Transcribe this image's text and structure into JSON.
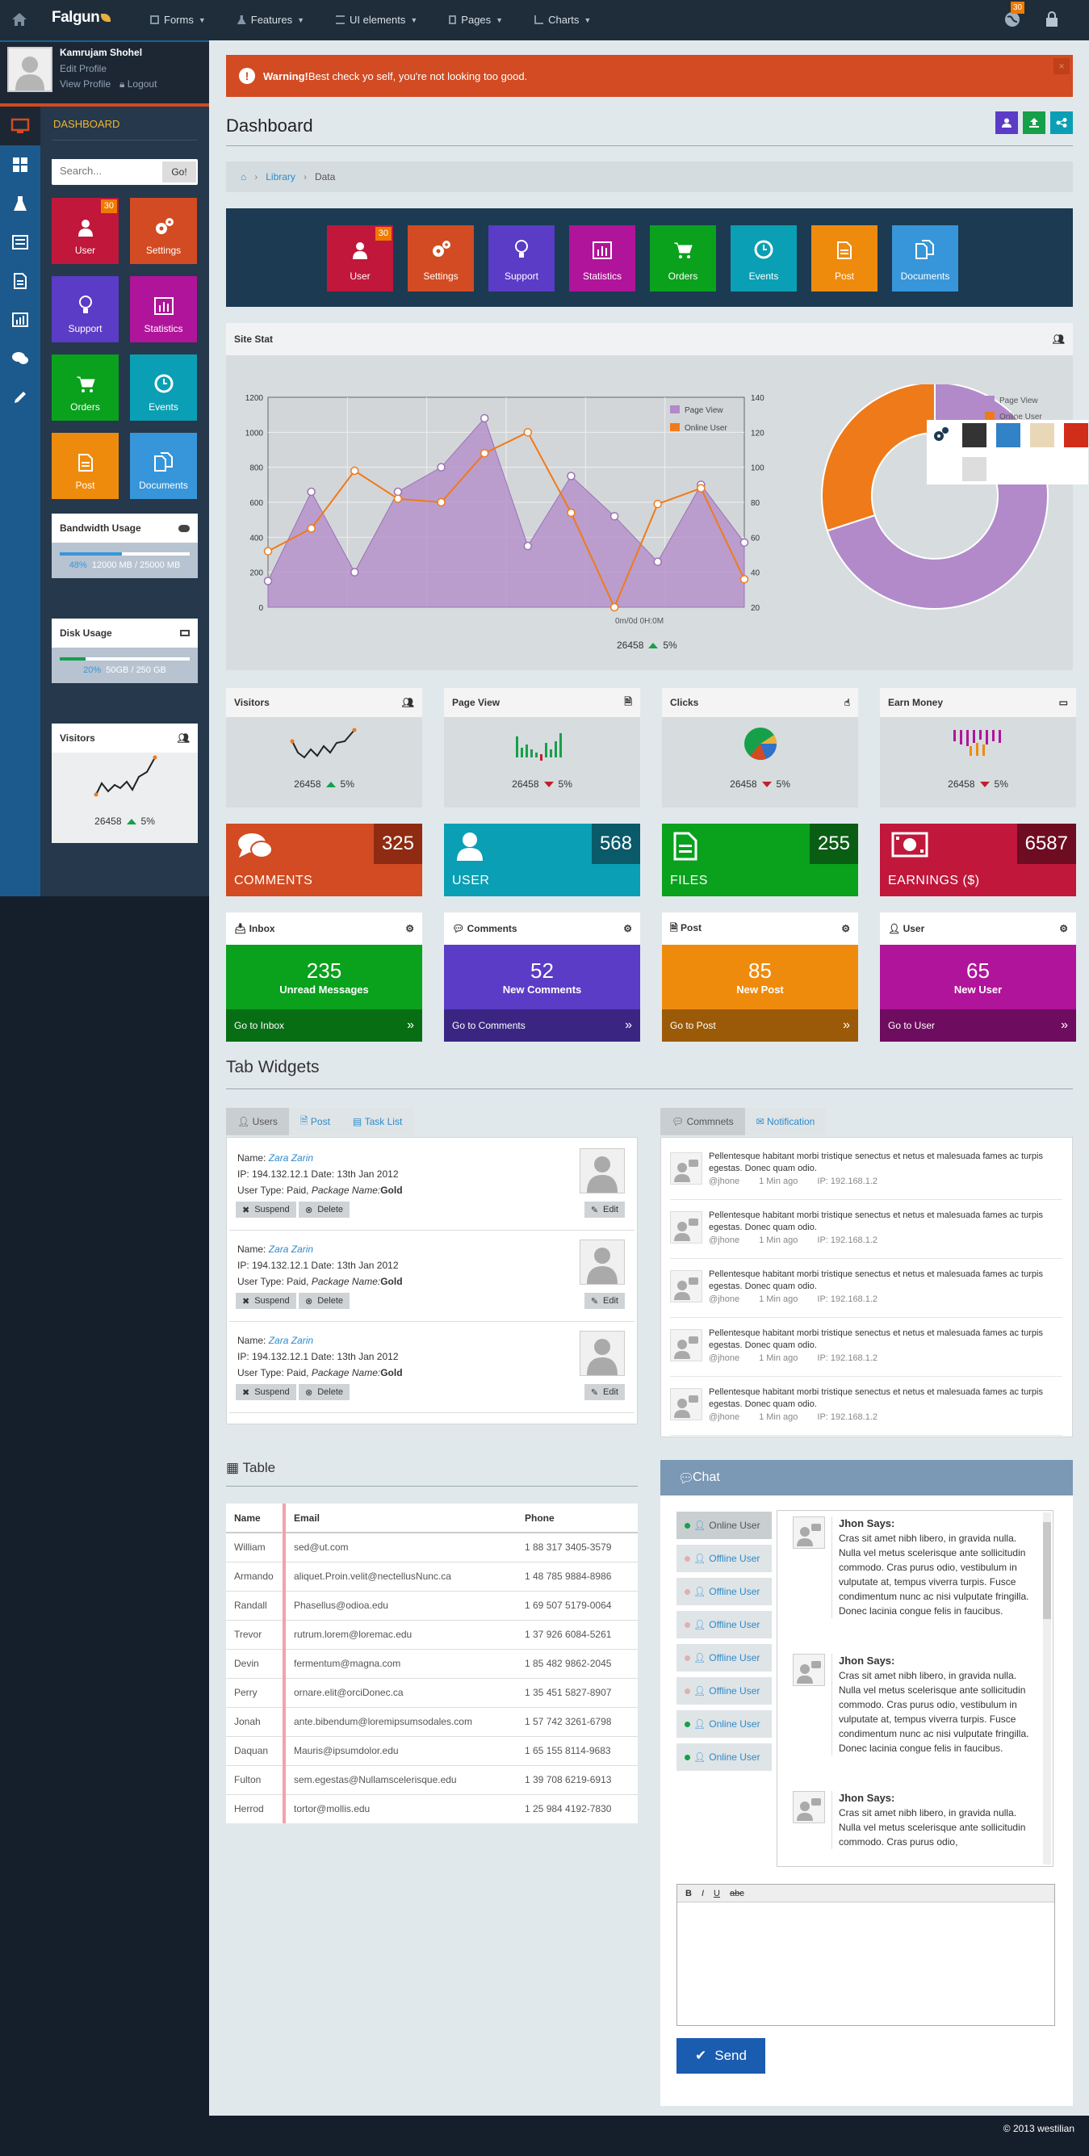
{
  "topbar": {
    "brand": "Falgun",
    "nav": [
      "Forms",
      "Features",
      "UI elements",
      "Pages",
      "Charts"
    ],
    "notif_count": "30"
  },
  "profile": {
    "name": "Kamrujam Shohel",
    "edit": "Edit Profile",
    "view": "View Profile",
    "logout": "Logout"
  },
  "sidebar": {
    "section": "DASHBOARD",
    "search_placeholder": "Search...",
    "search_go": "Go!",
    "tiles": [
      {
        "label": "User",
        "color": "#c0173b",
        "badge": "30"
      },
      {
        "label": "Settings",
        "color": "#d24b22"
      },
      {
        "label": "Support",
        "color": "#5a3cc6"
      },
      {
        "label": "Statistics",
        "color": "#b0149a"
      },
      {
        "label": "Orders",
        "color": "#0aa11d"
      },
      {
        "label": "Events",
        "color": "#0a9fb4"
      },
      {
        "label": "Post",
        "color": "#ef8b0c"
      },
      {
        "label": "Documents",
        "color": "#3796d9"
      }
    ],
    "bandwidth": {
      "title": "Bandwidth Usage",
      "percent": "48%",
      "detail": "12000 MB / 25000 MB",
      "fill": 0.48
    },
    "disk": {
      "title": "Disk Usage",
      "percent": "20%",
      "detail": "50GB / 250 GB",
      "fill": 0.2
    },
    "visitors": {
      "title": "Visitors",
      "value": "26458",
      "change": "5%"
    }
  },
  "alert": {
    "strong": "Warning!",
    "text": " Best check yo self, you're not looking too good."
  },
  "page": {
    "title": "Dashboard"
  },
  "breadcrumb": {
    "library": "Library",
    "current": "Data"
  },
  "hero_tiles": [
    {
      "label": "User",
      "color": "#c0173b",
      "badge": "30"
    },
    {
      "label": "Settings",
      "color": "#d24b22"
    },
    {
      "label": "Support",
      "color": "#5a3cc6"
    },
    {
      "label": "Statistics",
      "color": "#b0149a"
    },
    {
      "label": "Orders",
      "color": "#0aa11d"
    },
    {
      "label": "Events",
      "color": "#0a9fb4"
    },
    {
      "label": "Post",
      "color": "#ef8b0c"
    },
    {
      "label": "Documents",
      "color": "#3796d9"
    }
  ],
  "site_stat": {
    "title": "Site Stat",
    "footer_value": "26458",
    "footer_change": "5%",
    "overlay_text": "0m/0d 0H:0M"
  },
  "chart_data": [
    {
      "type": "line",
      "title": "Site Stat",
      "x": [
        0,
        1,
        2,
        3,
        4,
        5,
        6,
        7,
        8,
        9,
        10,
        11,
        12,
        13
      ],
      "y_left_range": [
        0,
        1200
      ],
      "y_right_range": [
        20,
        140
      ],
      "y_left_ticks": [
        0,
        200,
        400,
        600,
        800,
        1000,
        1200
      ],
      "y_right_ticks": [
        20,
        40,
        60,
        80,
        100,
        120,
        140
      ],
      "legend_position": "top-right",
      "series": [
        {
          "name": "Page View",
          "axis": "left",
          "kind": "area",
          "color": "#b28ac9",
          "values": [
            150,
            660,
            200,
            660,
            800,
            1080,
            350,
            750,
            520,
            260,
            700,
            370,
            0,
            0
          ]
        },
        {
          "name": "Online User",
          "axis": "right",
          "kind": "line",
          "color": "#ef7a1a",
          "values": [
            52,
            65,
            98,
            82,
            80,
            108,
            120,
            74,
            20,
            79,
            88,
            36,
            0,
            0
          ]
        }
      ]
    },
    {
      "type": "pie",
      "donut": true,
      "legend": [
        "Page View",
        "Online User"
      ],
      "values": [
        70,
        30
      ],
      "colors": [
        "#b28ac9",
        "#ef7a1a"
      ]
    }
  ],
  "stat_cards": [
    {
      "title": "Visitors",
      "value": "26458",
      "change": "5%",
      "dir": "up"
    },
    {
      "title": "Page View",
      "value": "26458",
      "change": "5%",
      "dir": "down"
    },
    {
      "title": "Clicks",
      "value": "26458",
      "change": "5%",
      "dir": "down"
    },
    {
      "title": "Earn Money",
      "value": "26458",
      "change": "5%",
      "dir": "down"
    }
  ],
  "metric_cards": [
    {
      "label": "COMMENTS",
      "value": "325",
      "color": "#d24b22",
      "dark": "#8f2b12"
    },
    {
      "label": "USER",
      "value": "568",
      "color": "#0a9fb4",
      "dark": "#0a5a6a"
    },
    {
      "label": "FILES",
      "value": "255",
      "color": "#0aa11d",
      "dark": "#0a5e14"
    },
    {
      "label": "EARNINGS ($)",
      "value": "6587",
      "color": "#c0173b",
      "dark": "#6e0c22"
    }
  ],
  "info_cards": [
    {
      "title": "Inbox",
      "number": "235",
      "text": "Unread Messages",
      "link": "Go to Inbox",
      "color": "#0aa11d",
      "dark": "#086e14"
    },
    {
      "title": "Comments",
      "number": "52",
      "text": "New Comments",
      "link": "Go to Comments",
      "color": "#5a3cc6",
      "dark": "#3a2682"
    },
    {
      "title": "Post",
      "number": "85",
      "text": "New Post",
      "link": "Go to Post",
      "color": "#ef8b0c",
      "dark": "#9a5a08"
    },
    {
      "title": "User",
      "number": "65",
      "text": "New User",
      "link": "Go to User",
      "color": "#b0149a",
      "dark": "#6e0c60"
    }
  ],
  "tab_widgets": {
    "title": "Tab Widgets",
    "left_tabs": [
      "Users",
      "Post",
      "Task List"
    ],
    "right_tabs": [
      "Commnets",
      "Notification"
    ],
    "users": [
      {
        "name_label": "Name:",
        "name": "Zara Zarin",
        "ip_line": "IP: 194.132.12.1 Date: 13th Jan 2012",
        "type_prefix": "User Type: Paid,",
        "pkg_label": "Package Name:",
        "pkg": "Gold"
      },
      {
        "name_label": "Name:",
        "name": "Zara Zarin",
        "ip_line": "IP: 194.132.12.1 Date: 13th Jan 2012",
        "type_prefix": "User Type: Paid,",
        "pkg_label": "Package Name:",
        "pkg": "Gold"
      },
      {
        "name_label": "Name:",
        "name": "Zara Zarin",
        "ip_line": "IP: 194.132.12.1 Date: 13th Jan 2012",
        "type_prefix": "User Type: Paid,",
        "pkg_label": "Package Name:",
        "pkg": "Gold"
      }
    ],
    "suspend": "Suspend",
    "delete": "Delete",
    "edit": "Edit",
    "comments": [
      {
        "text": "Pellentesque habitant morbi tristique senectus et netus et malesuada fames ac turpis egestas. Donec quam odio.",
        "user": "@jhone",
        "time": "1 Min ago",
        "ip": "IP: 192.168.1.2"
      },
      {
        "text": "Pellentesque habitant morbi tristique senectus et netus et malesuada fames ac turpis egestas. Donec quam odio.",
        "user": "@jhone",
        "time": "1 Min ago",
        "ip": "IP: 192.168.1.2"
      },
      {
        "text": "Pellentesque habitant morbi tristique senectus et netus et malesuada fames ac turpis egestas. Donec quam odio.",
        "user": "@jhone",
        "time": "1 Min ago",
        "ip": "IP: 192.168.1.2"
      },
      {
        "text": "Pellentesque habitant morbi tristique senectus et netus et malesuada fames ac turpis egestas. Donec quam odio.",
        "user": "@jhone",
        "time": "1 Min ago",
        "ip": "IP: 192.168.1.2"
      },
      {
        "text": "Pellentesque habitant morbi tristique senectus et netus et malesuada fames ac turpis egestas. Donec quam odio.",
        "user": "@jhone",
        "time": "1 Min ago",
        "ip": "IP: 192.168.1.2"
      }
    ]
  },
  "table": {
    "title": "Table",
    "headers": [
      "Name",
      "Email",
      "Phone"
    ],
    "rows": [
      [
        "William",
        "sed@ut.com",
        "1 88 317 3405-3579"
      ],
      [
        "Armando",
        "aliquet.Proin.velit@nectellusNunc.ca",
        "1 48 785 9884-8986"
      ],
      [
        "Randall",
        "Phasellus@odioa.edu",
        "1 69 507 5179-0064"
      ],
      [
        "Trevor",
        "rutrum.lorem@loremac.edu",
        "1 37 926 6084-5261"
      ],
      [
        "Devin",
        "fermentum@magna.com",
        "1 85 482 9862-2045"
      ],
      [
        "Perry",
        "ornare.elit@orciDonec.ca",
        "1 35 451 5827-8907"
      ],
      [
        "Jonah",
        "ante.bibendum@loremipsumsodales.com",
        "1 57 742 3261-6798"
      ],
      [
        "Daquan",
        "Mauris@ipsumdolor.edu",
        "1 65 155 8114-9683"
      ],
      [
        "Fulton",
        "sem.egestas@Nullamscelerisque.edu",
        "1 39 708 6219-6913"
      ],
      [
        "Herrod",
        "tortor@mollis.edu",
        "1 25 984 4192-7830"
      ]
    ]
  },
  "chat": {
    "title": "Chat",
    "users": [
      {
        "status": "Online User",
        "online": true,
        "active": true
      },
      {
        "status": "Offline User",
        "online": false
      },
      {
        "status": "Offline User",
        "online": false
      },
      {
        "status": "Offline User",
        "online": false
      },
      {
        "status": "Offline User",
        "online": false
      },
      {
        "status": "Offline User",
        "online": false
      },
      {
        "status": "Online User",
        "online": true
      },
      {
        "status": "Online User",
        "online": true
      }
    ],
    "messages": [
      {
        "sender": "Jhon Says:",
        "text": "Cras sit amet nibh libero, in gravida nulla. Nulla vel metus scelerisque ante sollicitudin commodo. Cras purus odio, vestibulum in vulputate at, tempus viverra turpis. Fusce condimentum nunc ac nisi vulputate fringilla. Donec lacinia congue felis in faucibus."
      },
      {
        "sender": "Jhon Says:",
        "text": "Cras sit amet nibh libero, in gravida nulla. Nulla vel metus scelerisque ante sollicitudin commodo. Cras purus odio, vestibulum in vulputate at, tempus viverra turpis. Fusce condimentum nunc ac nisi vulputate fringilla. Donec lacinia congue felis in faucibus."
      },
      {
        "sender": "Jhon Says:",
        "text": "Cras sit amet nibh libero, in gravida nulla. Nulla vel metus scelerisque ante sollicitudin commodo. Cras purus odio,"
      }
    ],
    "toolbar": [
      "B",
      "I",
      "U",
      "abc"
    ],
    "send": "Send"
  },
  "footer": {
    "text": "© 2013 westilian"
  },
  "theme_colors": [
    "#333333",
    "#3182c7",
    "#e9d8b8",
    "#d02d1b",
    "#dddddd"
  ]
}
